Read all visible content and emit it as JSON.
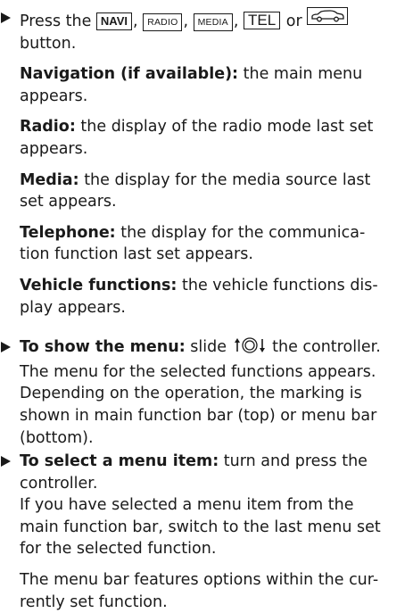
{
  "step1": {
    "press_word": "Press the",
    "keys": {
      "navi": "NAVI",
      "radio": "RADIO",
      "media": "MEDIA",
      "tel": "TEL",
      "vehicle": "car-icon"
    },
    "sep_comma": ",",
    "or_word": "or",
    "button_word": "button.",
    "paragraphs": [
      {
        "label": "Navigation (if available):",
        "lines": [
          " the main menu",
          "appears."
        ]
      },
      {
        "label": "Radio:",
        "lines": [
          " the display of the radio mode last set",
          "appears."
        ]
      },
      {
        "label": "Media:",
        "lines": [
          " the display for the media source last",
          "set appears."
        ]
      },
      {
        "label": "Telephone:",
        "lines": [
          " the display for the communica-",
          "tion function last set appears."
        ]
      },
      {
        "label": "Vehicle functions:",
        "lines": [
          " the vehicle functions dis-",
          "play appears."
        ]
      }
    ]
  },
  "step2": {
    "label": "To show the menu:",
    "text_before_icon": " slide ",
    "icon": "controller-slide-icon",
    "text_after_icon": " the controller.",
    "lines": [
      "The menu for the selected functions appears.",
      "Depending on the operation, the marking is",
      "shown in main function bar (top) or menu bar",
      "(bottom)."
    ]
  },
  "step3": {
    "label": "To select a menu item:",
    "first_line_rest": " turn and press the",
    "lines_a": [
      "controller.",
      "If you have selected a menu item from the",
      "main function bar, switch to the last menu set",
      "for the selected function."
    ],
    "lines_b": [
      "The menu bar features options within the cur-",
      "rently set function."
    ]
  }
}
